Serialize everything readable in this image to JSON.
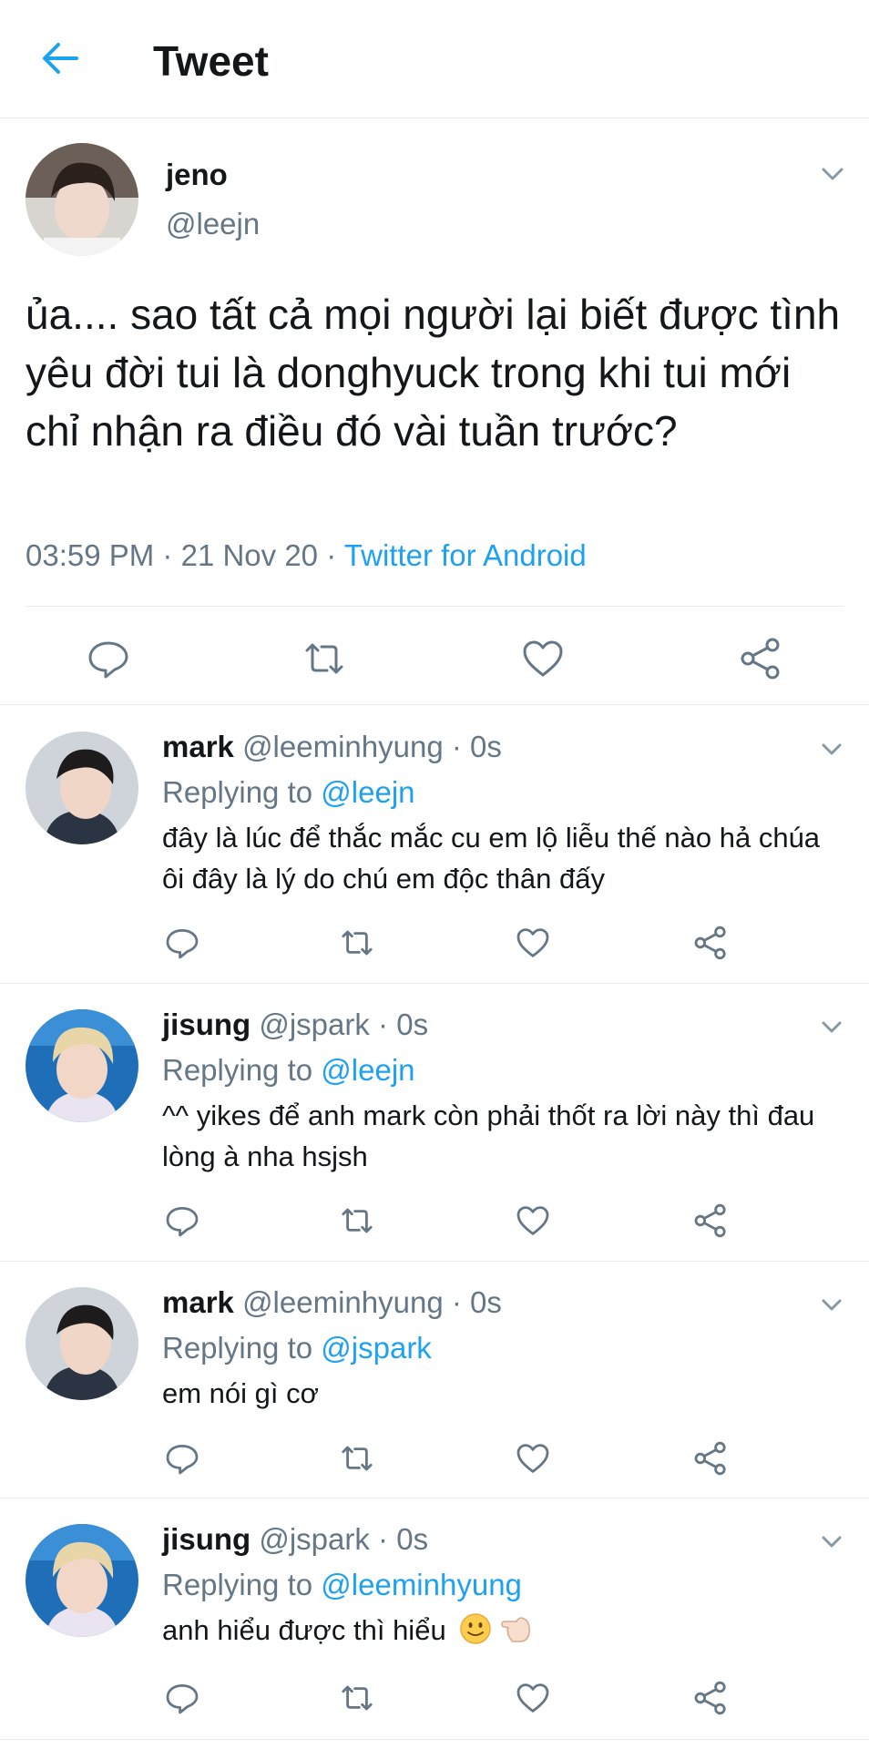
{
  "header": {
    "title": "Tweet"
  },
  "tweet": {
    "name": "jeno",
    "handle": "@leejn",
    "text": "ủa.... sao tất cả mọi người lại biết được tình yêu đời tui là donghyuck trong khi tui mới chỉ nhận ra điều đó vài tuần trước?",
    "time": "03:59 PM",
    "date": "21 Nov 20",
    "source": "Twitter for Android",
    "dot": "·"
  },
  "replies": [
    {
      "name": "mark",
      "handle": "@leeminhyung",
      "time": "0s",
      "replying_label": "Replying to",
      "replying_to": "@leejn",
      "text": "đây là lúc để thắc mắc cu em lộ liễu thế nào hả chúa ôi đây là lý do chú em độc thân đấy"
    },
    {
      "name": "jisung",
      "handle": "@jspark",
      "time": "0s",
      "replying_label": "Replying to",
      "replying_to": "@leejn",
      "text": "^^ yikes để anh mark còn phải thốt ra lời này thì đau lòng à nha hsjsh"
    },
    {
      "name": "mark",
      "handle": "@leeminhyung",
      "time": "0s",
      "replying_label": "Replying to",
      "replying_to": "@jspark",
      "text": "em nói gì cơ"
    },
    {
      "name": "jisung",
      "handle": "@jspark",
      "time": "0s",
      "replying_label": "Replying to",
      "replying_to": "@leeminhyung",
      "text": "anh hiểu được thì hiểu"
    }
  ],
  "colors": {
    "accent": "#1da1f2",
    "text": "#14171a",
    "muted": "#657786",
    "divider": "#e6ecf0"
  },
  "icons": [
    "back-arrow-icon",
    "chevron-down-icon",
    "reply-icon",
    "retweet-icon",
    "like-icon",
    "share-icon",
    "slightly-smiling-face-emoji",
    "backhand-index-pointing-left-emoji"
  ]
}
